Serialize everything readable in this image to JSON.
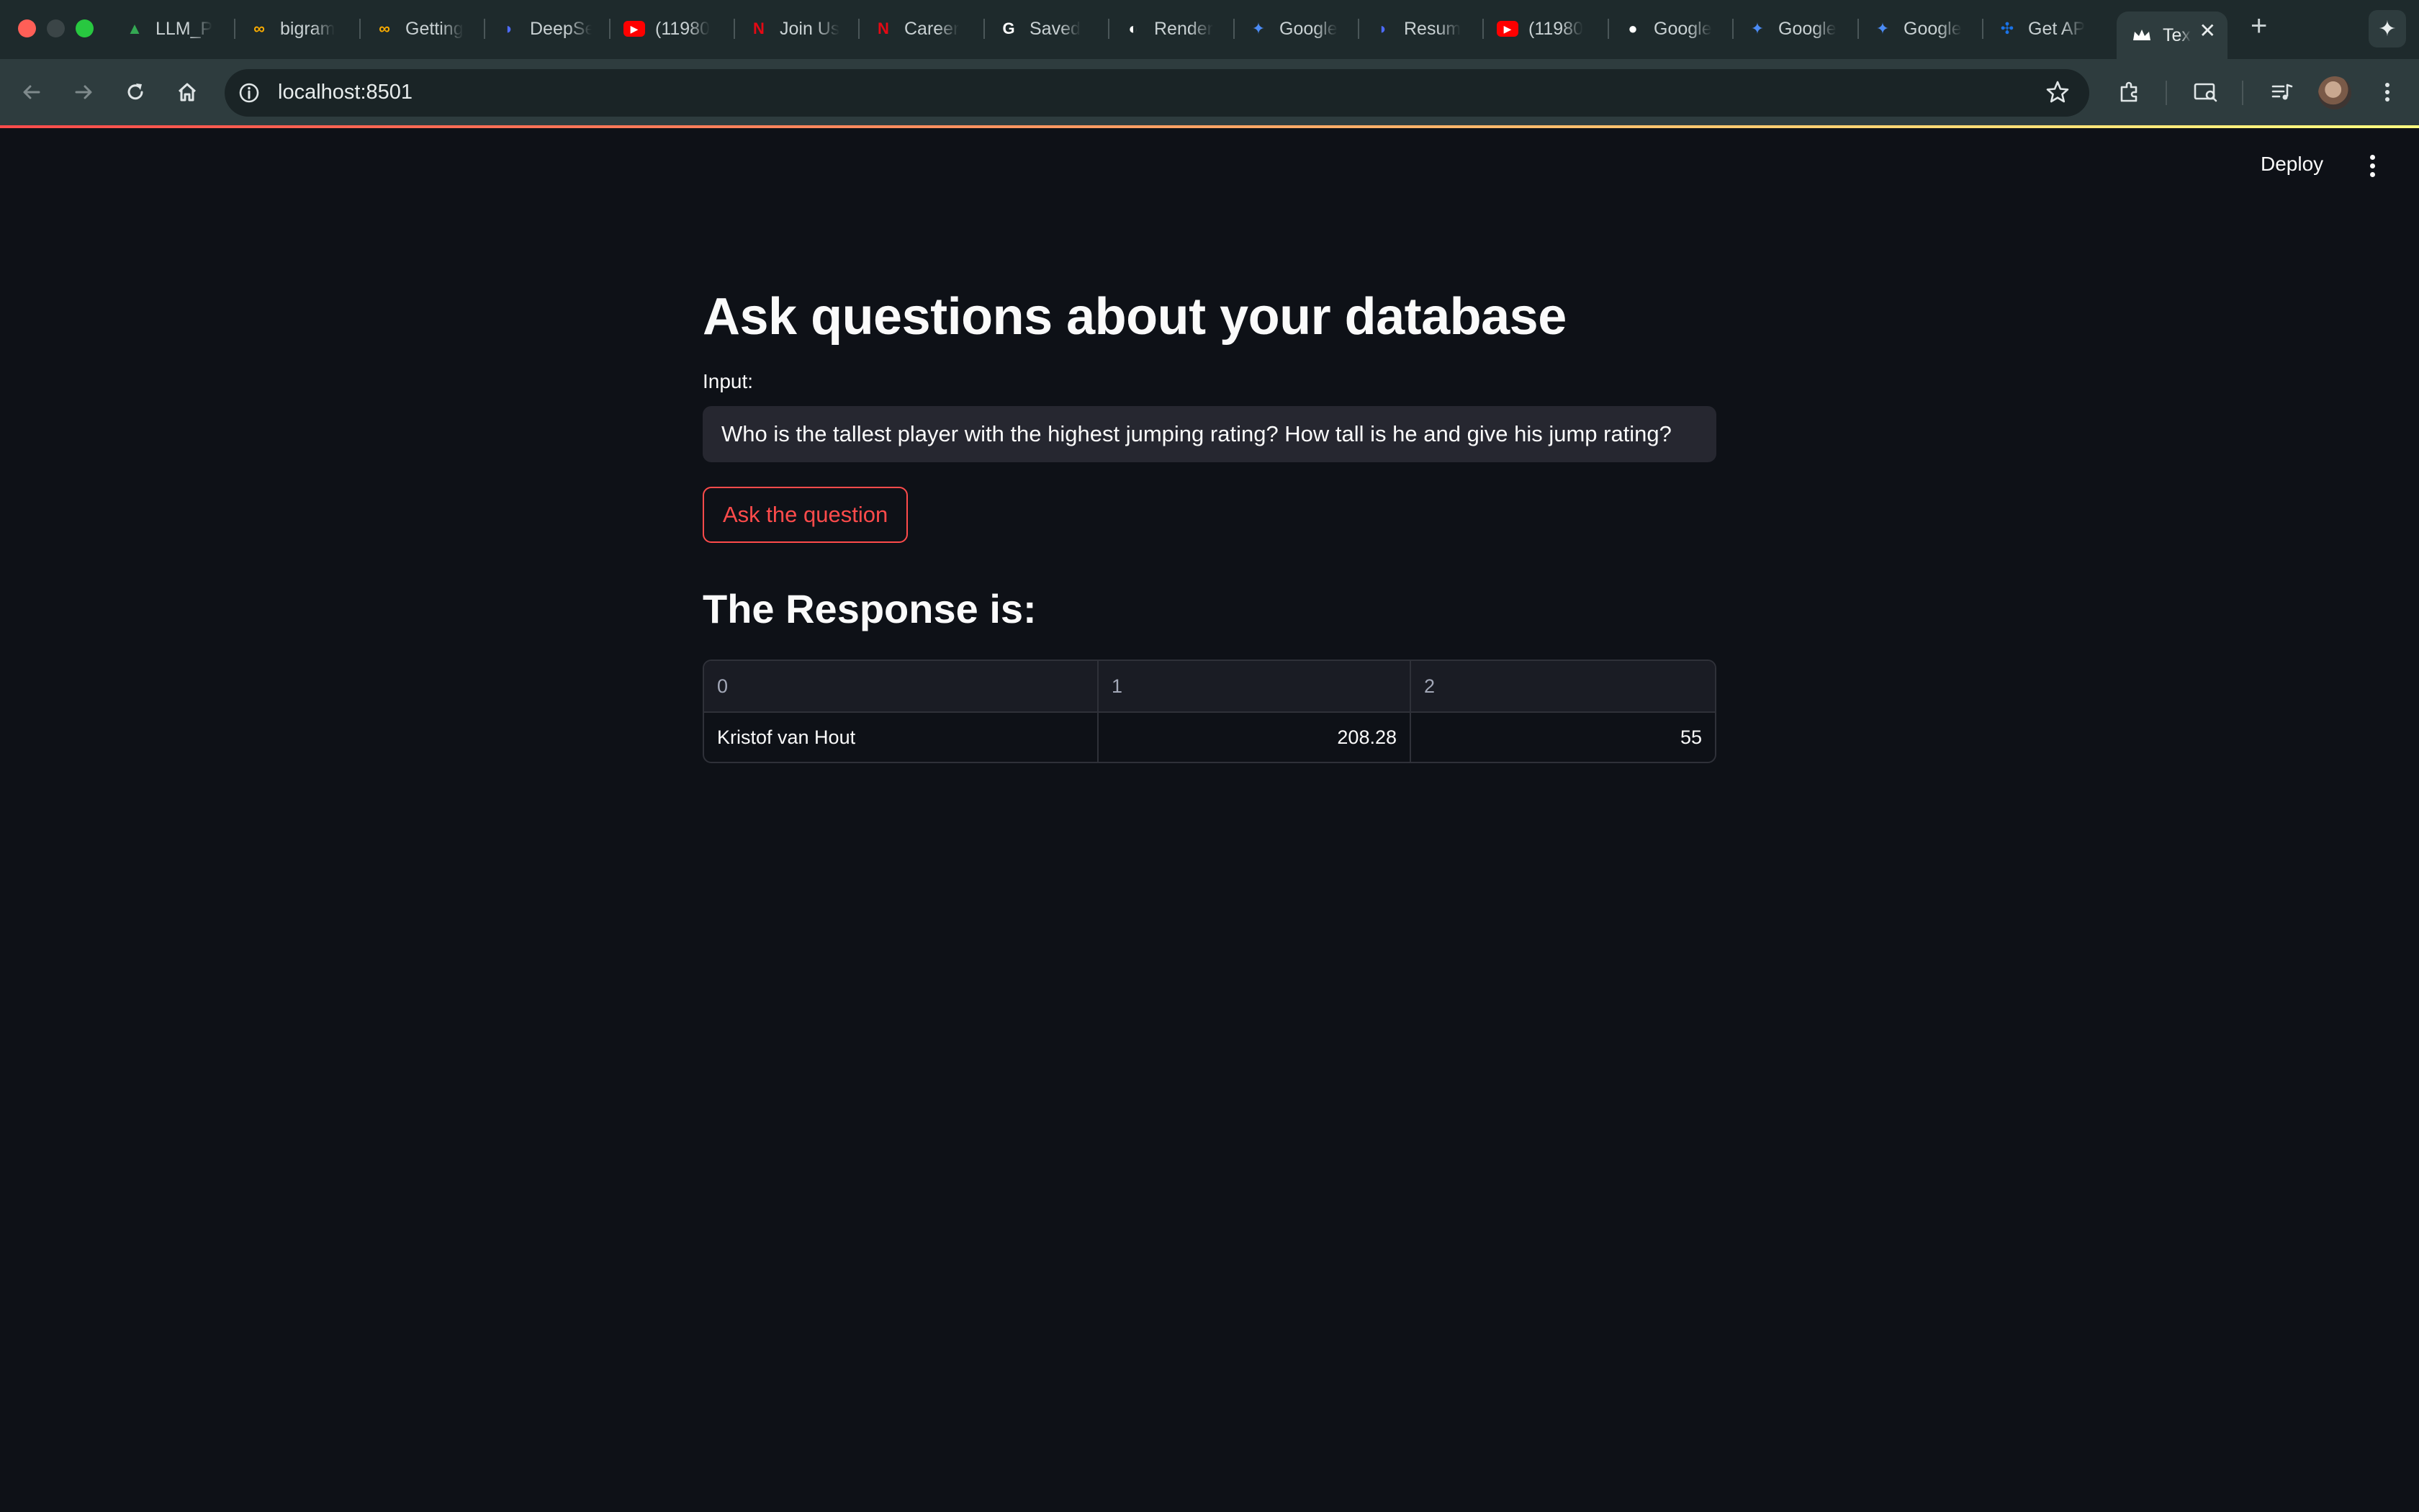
{
  "browser": {
    "tabs": [
      {
        "label": "LLM_P",
        "icon": "google-drive-icon",
        "color": "#34a853"
      },
      {
        "label": "bigram",
        "icon": "colab-icon",
        "color": "#f9ab00"
      },
      {
        "label": "Getting",
        "icon": "colab-icon",
        "color": "#f9ab00"
      },
      {
        "label": "DeepSe",
        "icon": "deepseek-icon",
        "color": "#4d6bfe"
      },
      {
        "label": "(11980",
        "icon": "youtube-icon",
        "color": "#ff0000"
      },
      {
        "label": "Join Us",
        "icon": "netflix-icon",
        "color": "#e50914"
      },
      {
        "label": "Career",
        "icon": "netflix-icon",
        "color": "#e50914"
      },
      {
        "label": "Saved",
        "icon": "google-icon",
        "color": "#ffffff"
      },
      {
        "label": "Render",
        "icon": "render-icon",
        "color": "#ffffff"
      },
      {
        "label": "Google",
        "icon": "gemini-icon",
        "color": "#4b8bf5"
      },
      {
        "label": "Resum",
        "icon": "deepseek-icon",
        "color": "#4d6bfe"
      },
      {
        "label": "(11980",
        "icon": "youtube-icon",
        "color": "#ff0000"
      },
      {
        "label": "Google",
        "icon": "github-icon",
        "color": "#ffffff"
      },
      {
        "label": "Google",
        "icon": "gemini-icon",
        "color": "#4b8bf5"
      },
      {
        "label": "Google",
        "icon": "gemini-icon",
        "color": "#4b8bf5"
      },
      {
        "label": "Get AP",
        "icon": "api-icon",
        "color": "#1a73e8"
      }
    ],
    "active_tab": {
      "label": "Tex",
      "icon": "streamlit-crown-icon"
    },
    "url": "localhost:8501"
  },
  "header": {
    "deploy_label": "Deploy"
  },
  "main": {
    "title": "Ask questions about your database",
    "input_label": "Input:",
    "input_value": "Who is the tallest player with the highest jumping rating? How tall is he and give his jump rating?",
    "button_label": "Ask the question",
    "response_heading": "The Response is:",
    "table": {
      "columns": [
        "0",
        "1",
        "2"
      ],
      "rows": [
        [
          "Kristof van Hout",
          "208.28",
          "55"
        ]
      ]
    }
  },
  "colors": {
    "background": "#0e1117",
    "primary": "#ff4b4b",
    "input_bg": "#262730",
    "chrome_frame": "#1e2a2c",
    "chrome_toolbar": "#2e3c3e"
  }
}
